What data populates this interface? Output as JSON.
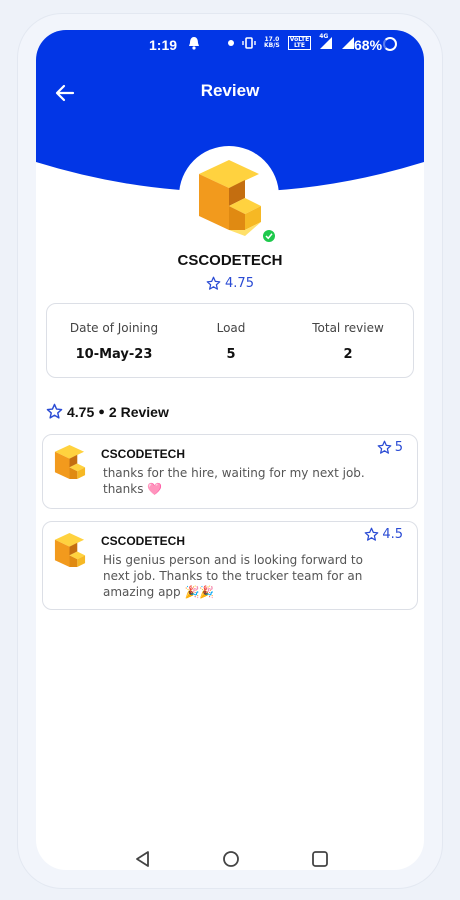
{
  "status_bar": {
    "time": "1:19",
    "speed_value": "17.0",
    "speed_unit": "KB/S",
    "volte_top": "VoLTE",
    "volte_bottom": "LTE",
    "network": "4G",
    "battery": "68%"
  },
  "header": {
    "title": "Review",
    "accent_color": "#0236e6"
  },
  "profile": {
    "name": "CSCODETECH",
    "rating": "4.75"
  },
  "stats": [
    {
      "label": "Date of Joining",
      "value": "10-May-23"
    },
    {
      "label": "Load",
      "value": "5"
    },
    {
      "label": "Total review",
      "value": "2"
    }
  ],
  "summary": {
    "rating": "4.75",
    "separator": "●",
    "count_text": "2 Review"
  },
  "reviews": [
    {
      "name": "CSCODETECH",
      "text": "thanks for the hire, waiting for my next job. thanks 🩷",
      "rating": "5"
    },
    {
      "name": "CSCODETECH",
      "text": "His genius person and is looking forward to next job. Thanks to the trucker team for an amazing app 🎉🎉",
      "rating": "4.5"
    }
  ],
  "icons": {
    "back": "arrow-left-icon",
    "star": "star-outline-icon",
    "verified": "check-badge-icon",
    "nav_back": "triangle-back-icon",
    "nav_home": "circle-home-icon",
    "nav_recent": "square-recent-icon"
  }
}
